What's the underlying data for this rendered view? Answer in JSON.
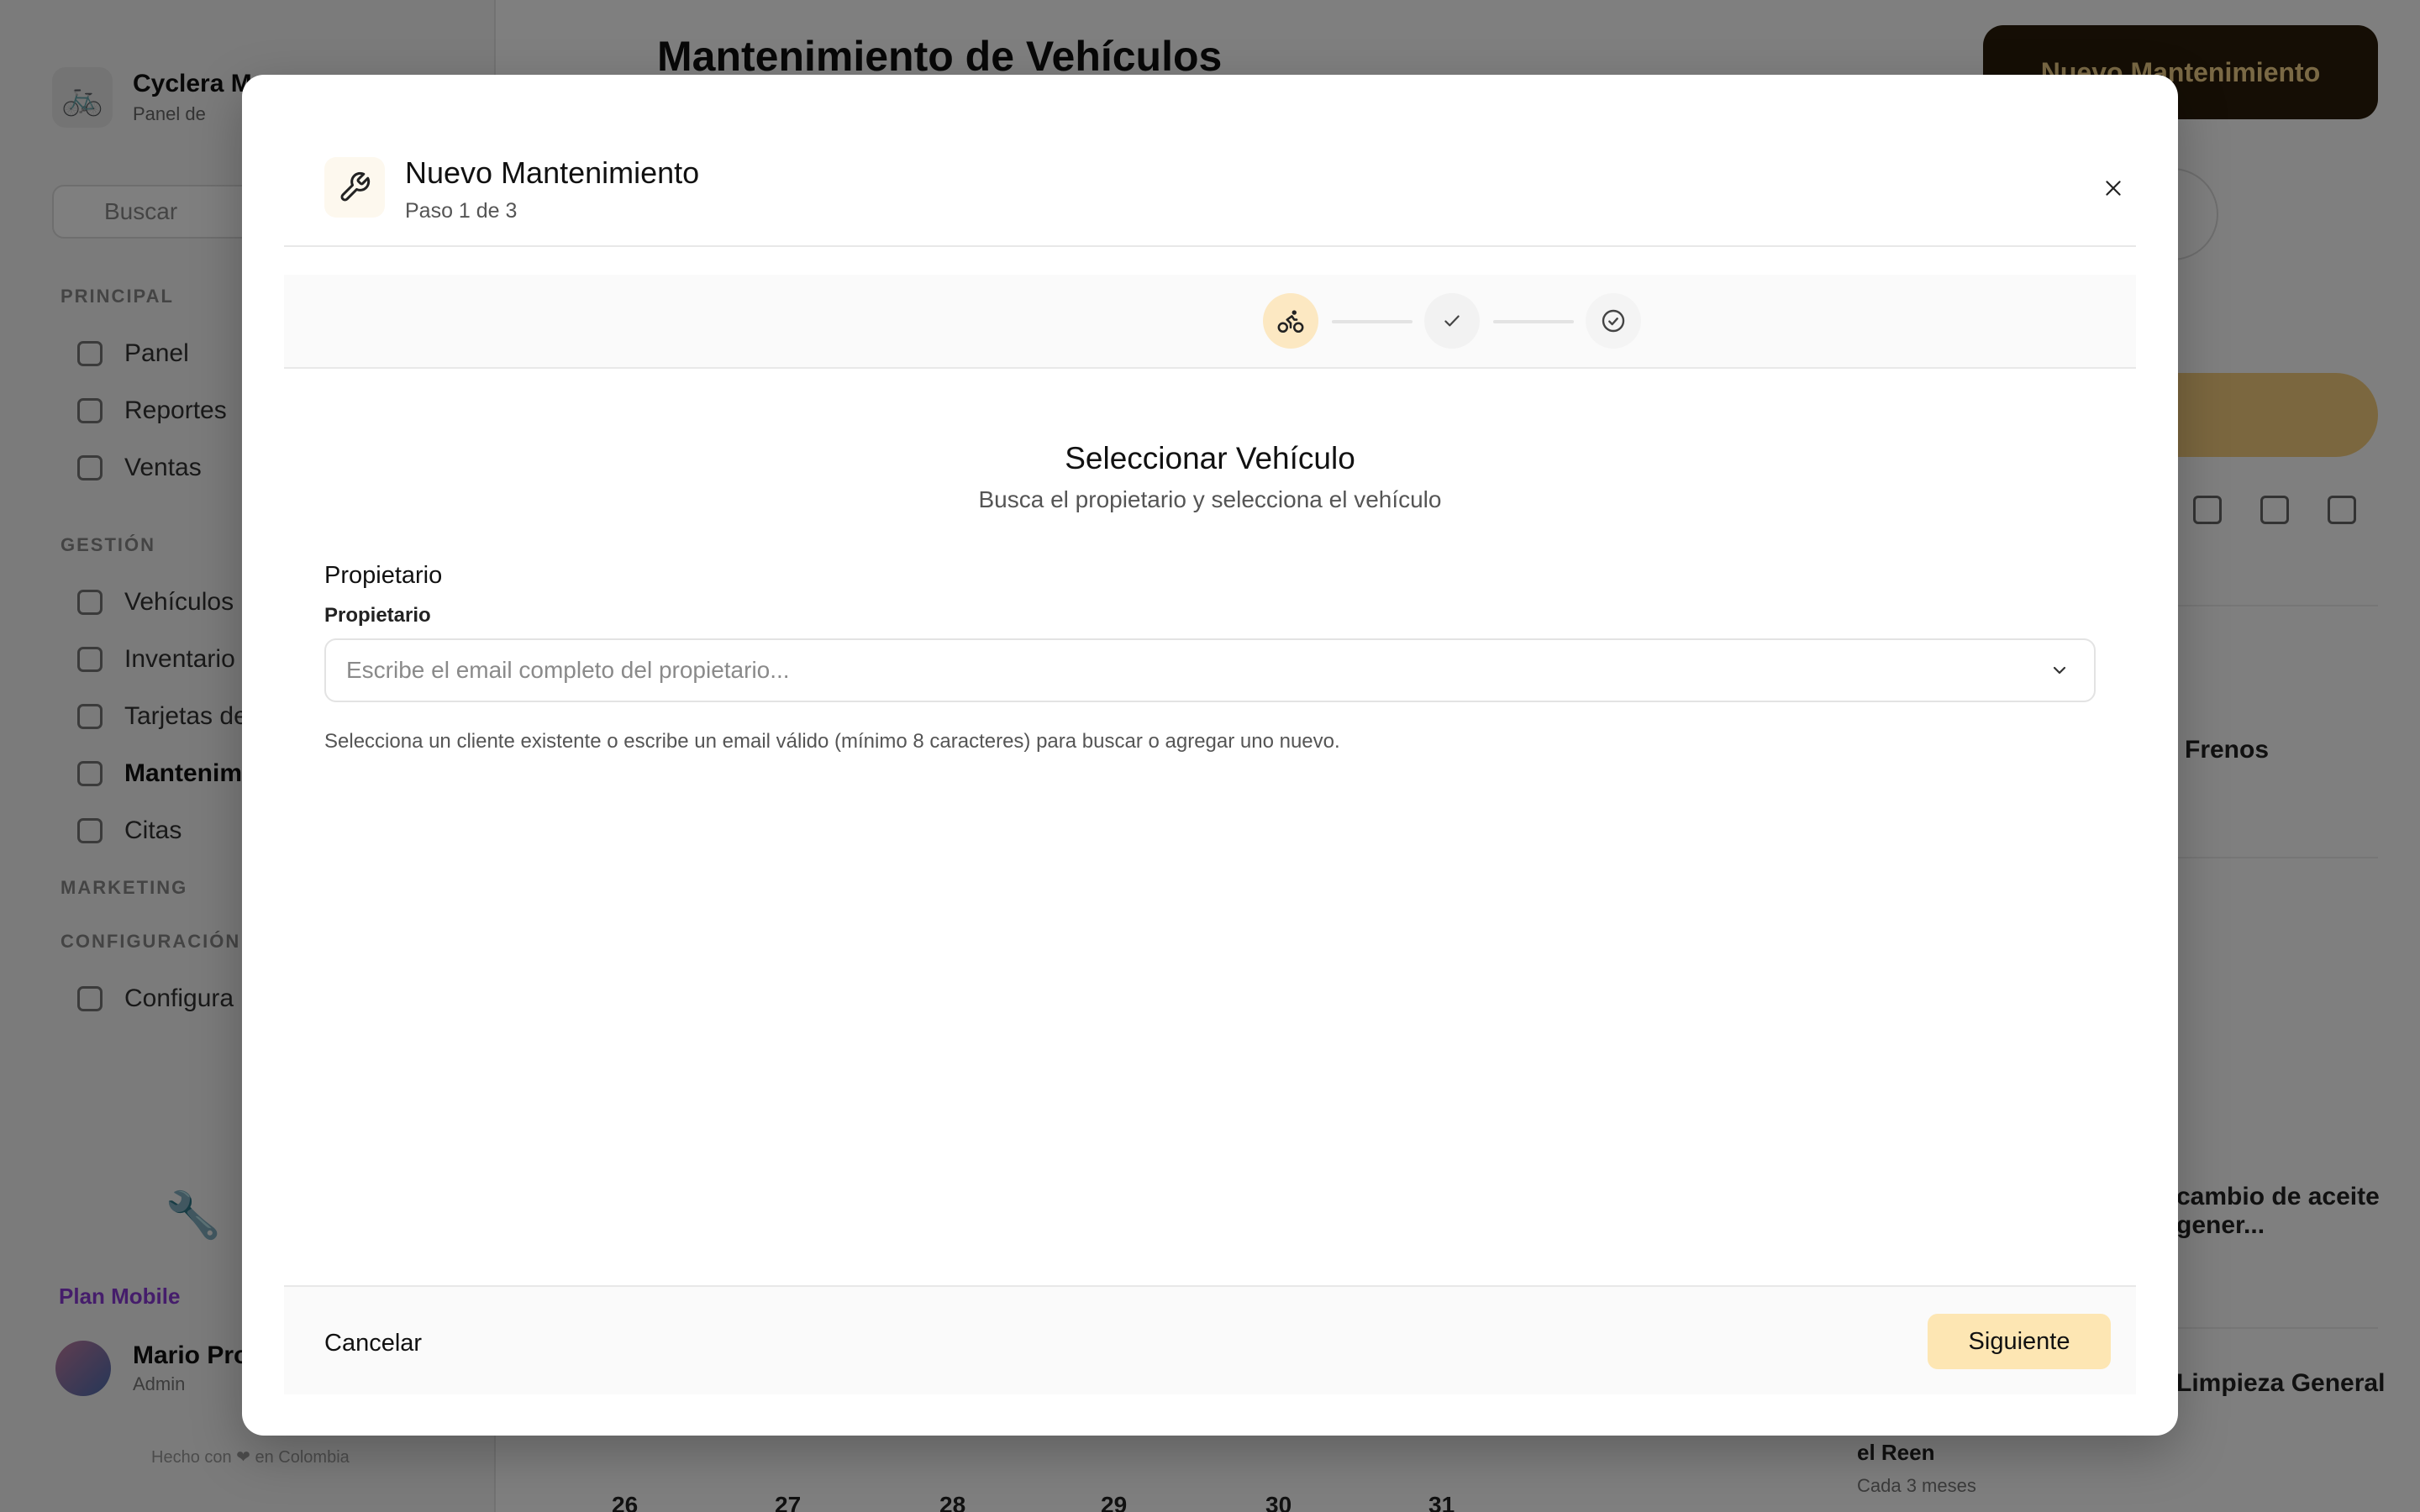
{
  "background": {
    "brand": {
      "name": "Cyclera M",
      "sub": "Panel de"
    },
    "search_placeholder": "Buscar",
    "sections": {
      "principal": "PRINCIPAL",
      "gestion": "GESTIÓN",
      "marketing": "MARKETING",
      "configuracion": "CONFIGURACIÓN"
    },
    "nav": {
      "panel": "Panel",
      "reportes": "Reportes",
      "ventas": "Ventas",
      "vehiculos": "Vehículos",
      "inventario": "Inventario",
      "tarjetas": "Tarjetas de",
      "mantenimiento": "Mantenimi",
      "citas": "Citas",
      "configuracion": "Configura"
    },
    "plan": "Plan Mobile",
    "user": {
      "name": "Mario Prop",
      "role": "Admin"
    },
    "footer": "Hecho con ❤ en Colombia",
    "page_title": "Mantenimiento de Vehículos",
    "new_button": "Nuevo Mantenimiento",
    "card_texts": {
      "a": "Frenos",
      "b": "cambio de aceite gener...",
      "c": "Limpieza General",
      "d": "el Reen",
      "e": "Cada 3 meses"
    },
    "calendar_days": [
      "26",
      "27",
      "28",
      "29",
      "30",
      "31"
    ]
  },
  "modal": {
    "title": "Nuevo Mantenimiento",
    "step_indicator": "Paso 1 de 3",
    "stepper": {
      "current_step": 1,
      "total_steps": 3
    },
    "section_title": "Seleccionar Vehículo",
    "section_subtitle": "Busca el propietario y selecciona el vehículo",
    "group_label": "Propietario",
    "owner_field": {
      "label": "Propietario",
      "placeholder": "Escribe el email completo del propietario...",
      "value": ""
    },
    "help_text": "Selecciona un cliente existente o escribe un email válido (mínimo 8 caracteres) para buscar o agregar uno nuevo.",
    "cancel_label": "Cancelar",
    "next_label": "Siguiente"
  },
  "colors": {
    "accent": "#fde6b3",
    "step_active": "#fce8c2",
    "overlay": "rgba(0,0,0,0.5)",
    "brand_dark": "#2b1d0a"
  },
  "icons": {
    "header": "wrench-icon",
    "close": "close-icon",
    "step_1": "bicycle-icon",
    "step_2": "check-icon",
    "step_3": "check-circle-icon",
    "field": "chevron-down-icon"
  }
}
